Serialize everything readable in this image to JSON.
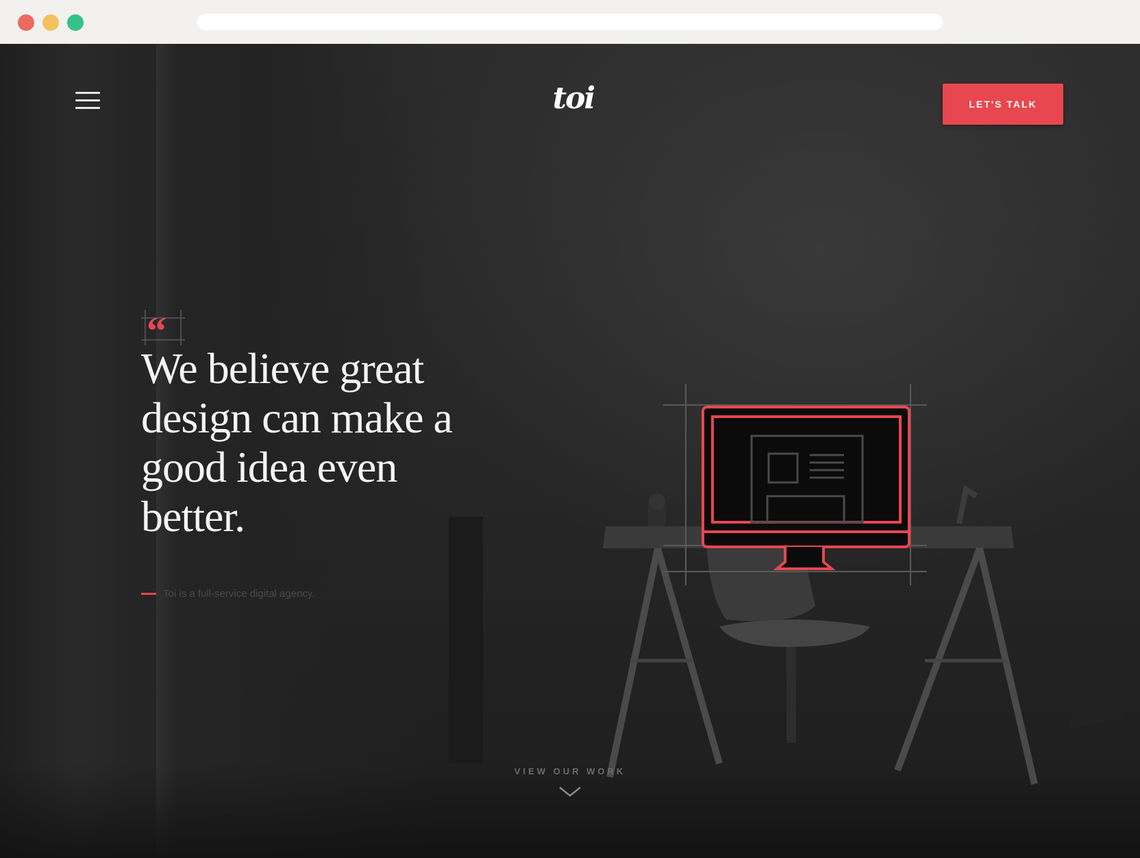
{
  "browser": {
    "traffic_lights": [
      "#ec6a5e",
      "#f4c25c",
      "#33c28b"
    ]
  },
  "header": {
    "logo_text": "toi",
    "cta_label": "LET'S TALK"
  },
  "hero": {
    "headline": "We believe great design can make a good idea even better.",
    "tagline": "Toi is a full-service digital agency."
  },
  "footer": {
    "view_work_label": "VIEW OUR WORK"
  },
  "colors": {
    "accent": "#e8474f"
  },
  "icons": {
    "menu": "hamburger-menu-icon",
    "quote": "quotation-mark-icon",
    "monitor": "monitor-illustration-icon",
    "scroll": "chevron-down-icon"
  }
}
